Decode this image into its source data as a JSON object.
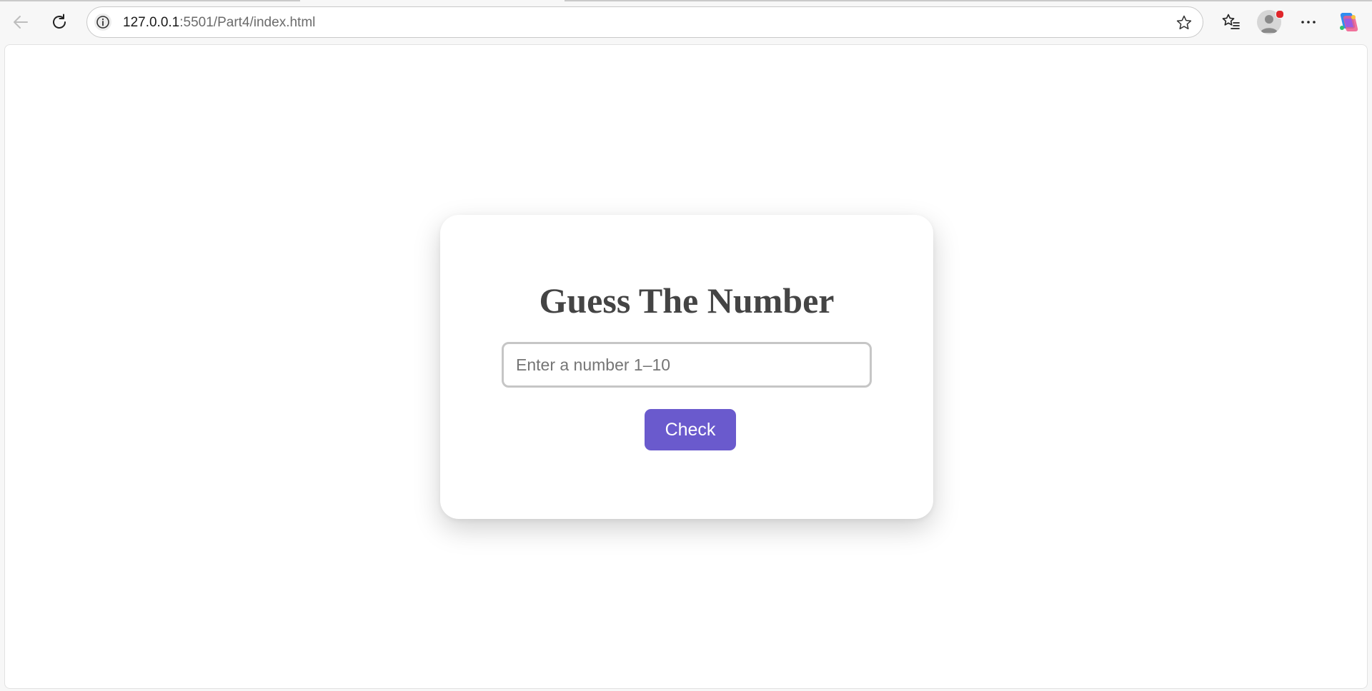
{
  "browser": {
    "url_host": "127.0.0.1",
    "url_path": ":5501/Part4/index.html",
    "icons": {
      "back": "back-arrow-icon",
      "reload": "reload-icon",
      "site_info": "info-icon",
      "favorite": "star-icon",
      "favorites_list": "favorites-icon",
      "profile": "avatar",
      "more": "more-icon",
      "copilot": "copilot-icon"
    }
  },
  "page": {
    "title": "Guess The Number",
    "input_placeholder": "Enter a number 1–10",
    "input_value": "",
    "check_label": "Check"
  },
  "colors": {
    "accent": "#6a5acd",
    "title": "#444444",
    "input_border": "#c6c6c6",
    "notification_dot": "#e0262b"
  }
}
